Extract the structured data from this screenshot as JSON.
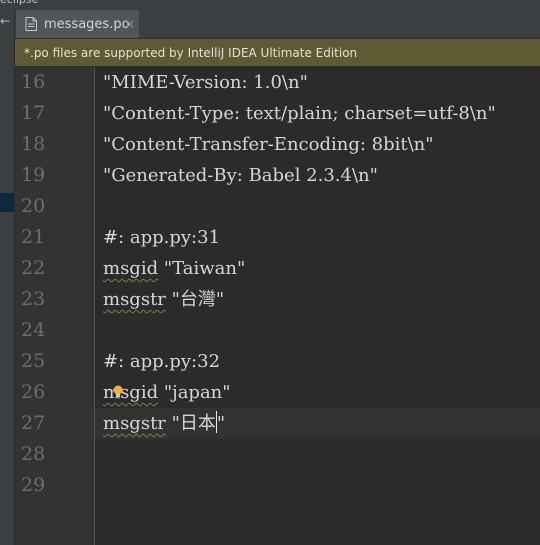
{
  "window": {
    "top_label": "eclipse"
  },
  "tab": {
    "file_icon": "file-icon",
    "label": "messages.po",
    "close_icon": "close-icon",
    "close_glyph": "×"
  },
  "banner": {
    "text": "*.po files are supported by IntelliJ IDEA Ultimate Edition"
  },
  "colors": {
    "background": "#2b2b2b",
    "banner": "#5d5a34",
    "gutter": "#313335",
    "tab_active": "#515658",
    "squiggle": "#5f8d4e"
  },
  "editor": {
    "lines": [
      {
        "num": "16",
        "text": "\"MIME-Version: 1.0\\n\""
      },
      {
        "num": "17",
        "text": "\"Content-Type: text/plain; charset=utf-8\\n\""
      },
      {
        "num": "18",
        "text": "\"Content-Transfer-Encoding: 8bit\\n\""
      },
      {
        "num": "19",
        "text": "\"Generated-By: Babel 2.3.4\\n\""
      },
      {
        "num": "20",
        "text": ""
      },
      {
        "num": "21",
        "text": "#: app.py:31"
      },
      {
        "num": "22",
        "keyword": "msgid",
        "rest": " \"Taiwan\""
      },
      {
        "num": "23",
        "keyword": "msgstr",
        "rest": " \"台灣\""
      },
      {
        "num": "24",
        "text": ""
      },
      {
        "num": "25",
        "text": "#: app.py:32"
      },
      {
        "num": "26",
        "keyword": "msgid",
        "rest": " \"japan\""
      },
      {
        "num": "27",
        "keyword": "msgstr",
        "rest_before_caret": " \"日本",
        "rest_after_caret": "\""
      },
      {
        "num": "28",
        "text": ""
      },
      {
        "num": "29",
        "text": ""
      }
    ],
    "intention_icon": "lightbulb-icon"
  }
}
